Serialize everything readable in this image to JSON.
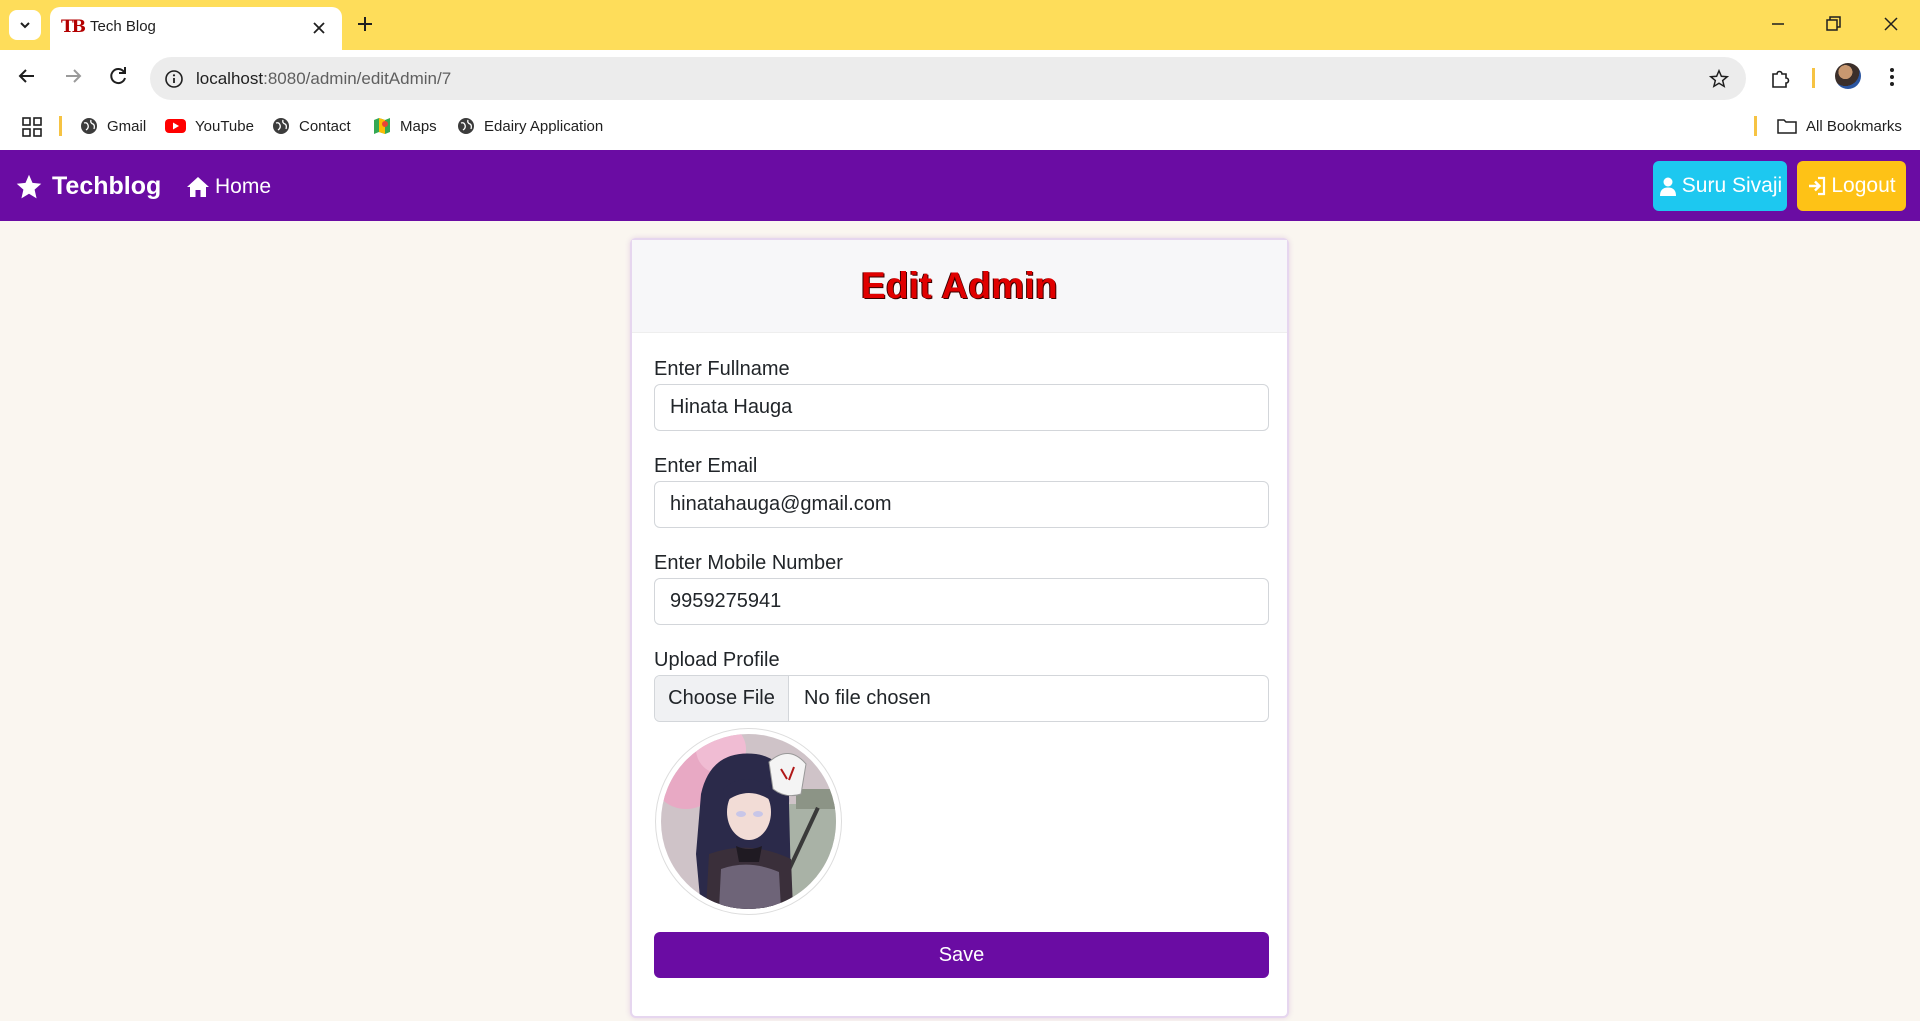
{
  "browser": {
    "tab_title": "Tech Blog",
    "tab_favicon_text": "TB",
    "url_host": "localhost",
    "url_path": ":8080/admin/editAdmin/7",
    "bookmarks": [
      {
        "label": "Gmail",
        "icon": "globe-icon"
      },
      {
        "label": "YouTube",
        "icon": "youtube-icon"
      },
      {
        "label": "Contact",
        "icon": "globe-icon"
      },
      {
        "label": "Maps",
        "icon": "maps-icon"
      },
      {
        "label": "Edairy Application",
        "icon": "globe-icon"
      }
    ],
    "all_bookmarks_label": "All Bookmarks",
    "chrome_color": "#fedd5a"
  },
  "navbar": {
    "brand": "Techblog",
    "home_label": "Home",
    "user_label": "Suru Sivaji",
    "logout_label": "Logout",
    "bg_color": "#6a0ca3"
  },
  "form": {
    "title": "Edit Admin",
    "fullname_label": "Enter Fullname",
    "fullname_value": "Hinata Hauga",
    "email_label": "Enter Email",
    "email_value": "hinatahauga@gmail.com",
    "mobile_label": "Enter Mobile Number",
    "mobile_value": "9959275941",
    "upload_label": "Upload Profile",
    "choose_file_label": "Choose File",
    "no_file_label": "No file chosen",
    "save_label": "Save"
  }
}
